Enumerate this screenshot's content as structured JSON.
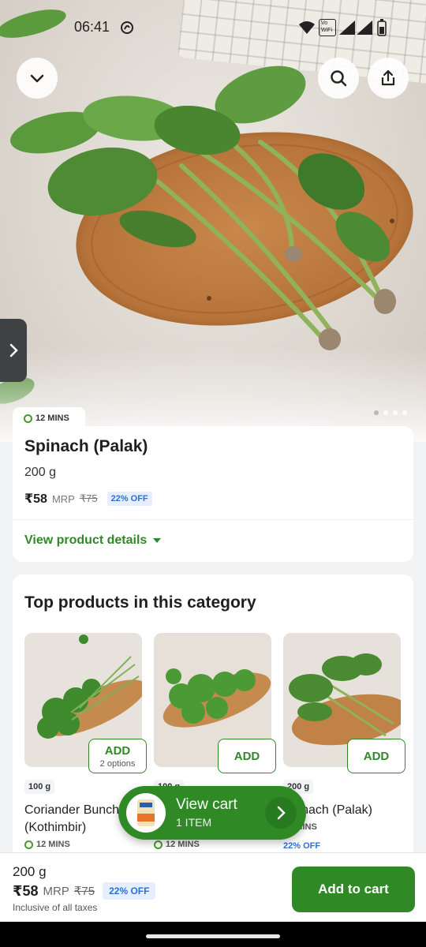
{
  "status_bar": {
    "time": "06:41",
    "network_label_top": "Vo",
    "network_label_bottom": "WiFi",
    "network_num": "2"
  },
  "hero": {
    "image_alt": "Spinach leaves on a wooden board",
    "carousel_pages": 4,
    "carousel_active": 1
  },
  "product": {
    "delivery_time": "12 MINS",
    "name": "Spinach (Palak)",
    "weight": "200 g",
    "price": "₹58",
    "mrp_label": "MRP",
    "mrp_value": "₹75",
    "discount": "22% OFF",
    "details_link": "View product details"
  },
  "top_products": {
    "title": "Top products in this category",
    "items": [
      {
        "weight": "100 g",
        "name": "Coriander Bunch (Kothimbir)",
        "add_label": "ADD",
        "options": "2 options",
        "delivery_time": "12 MINS"
      },
      {
        "weight": "100 g",
        "name": "",
        "add_label": "ADD",
        "options": "",
        "delivery_time": "12 MINS"
      },
      {
        "weight": "200 g",
        "name": "Spinach (Palak)",
        "add_label": "ADD",
        "options": "",
        "delivery_time": "12 MINS",
        "discount": "22% OFF"
      }
    ]
  },
  "cart_pill": {
    "title": "View cart",
    "subtitle": "1 ITEM"
  },
  "bottom_bar": {
    "weight": "200 g",
    "price": "₹58",
    "mrp_label": "MRP",
    "mrp_value": "₹75",
    "discount": "22% OFF",
    "tax_note": "Inclusive of all taxes",
    "add_to_cart": "Add to cart"
  },
  "colors": {
    "brand_green": "#2f8a26",
    "discount_blue": "#2c6fd6"
  }
}
